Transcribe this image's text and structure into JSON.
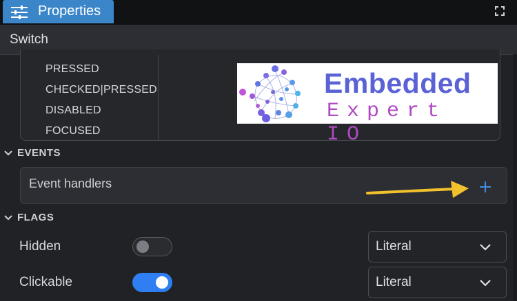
{
  "window": {
    "tab_label": "Properties",
    "tab_icon": "sliders-icon",
    "maximize_icon": "maximize-icon",
    "accent": "#3b86c9"
  },
  "component": {
    "name": "Switch"
  },
  "states": {
    "items": [
      "PRESSED",
      "CHECKED|PRESSED",
      "DISABLED",
      "FOCUSED"
    ]
  },
  "logo": {
    "title": "Embedded",
    "subtitle": "Expert IO",
    "title_color": "#5a62d6",
    "subtitle_color": "#b04ac2"
  },
  "events": {
    "section_label": "EVENTS",
    "handlers_label": "Event handlers",
    "add_icon": "plus-icon",
    "add_color": "#3b8fe0",
    "arrow_color": "#f2c12e"
  },
  "flags": {
    "section_label": "FLAGS",
    "rows": [
      {
        "label": "Hidden",
        "enabled": false,
        "select_value": "Literal"
      },
      {
        "label": "Clickable",
        "enabled": true,
        "select_value": "Literal"
      }
    ],
    "toggle_on_color": "#2f7ff2"
  }
}
